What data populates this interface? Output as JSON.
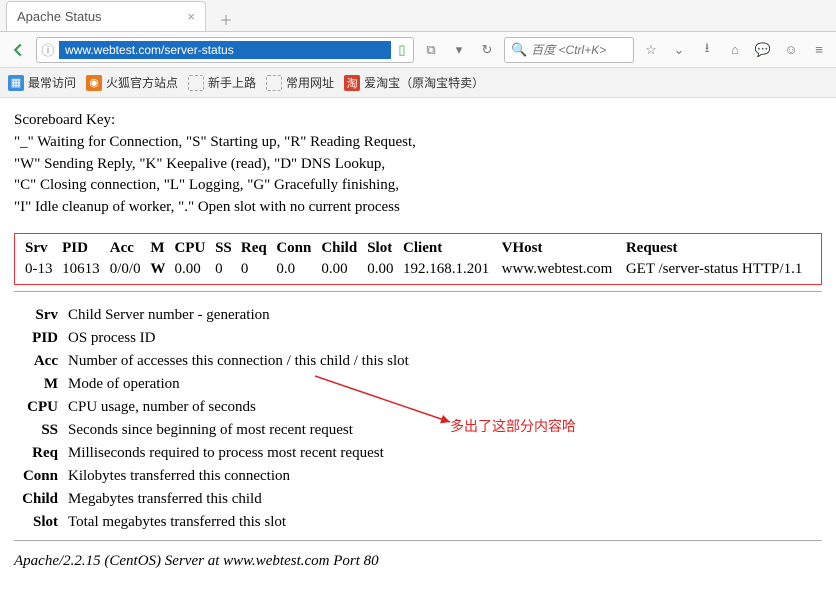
{
  "browser": {
    "tab_title": "Apache Status",
    "url": "www.webtest.com/server-status",
    "search_placeholder": "百度 <Ctrl+K>",
    "bookmarks": [
      {
        "label": "最常访问"
      },
      {
        "label": "火狐官方站点"
      },
      {
        "label": "新手上路"
      },
      {
        "label": "常用网址"
      },
      {
        "label": "爱淘宝（原淘宝特卖）"
      }
    ]
  },
  "scoreboard": {
    "title": "Scoreboard Key:",
    "lines": [
      "\"_\" Waiting for Connection, \"S\" Starting up, \"R\" Reading Request,",
      "\"W\" Sending Reply, \"K\" Keepalive (read), \"D\" DNS Lookup,",
      "\"C\" Closing connection, \"L\" Logging, \"G\" Gracefully finishing,",
      "\"I\" Idle cleanup of worker, \".\" Open slot with no current process"
    ]
  },
  "table": {
    "headers": [
      "Srv",
      "PID",
      "Acc",
      "M",
      "CPU",
      "SS",
      "Req",
      "Conn",
      "Child",
      "Slot",
      "Client",
      "VHost",
      "Request"
    ],
    "row": {
      "Srv": "0-13",
      "PID": "10613",
      "Acc": "0/0/0",
      "M": "W",
      "CPU": "0.00",
      "SS": "0",
      "Req": "0",
      "Conn": "0.0",
      "Child": "0.00",
      "Slot": "0.00",
      "Client": "192.168.1.201",
      "VHost": "www.webtest.com",
      "Request": "GET /server-status HTTP/1.1"
    }
  },
  "defs": [
    {
      "k": "Srv",
      "v": "Child Server number - generation"
    },
    {
      "k": "PID",
      "v": "OS process ID"
    },
    {
      "k": "Acc",
      "v": "Number of accesses this connection / this child / this slot"
    },
    {
      "k": "M",
      "v": "Mode of operation"
    },
    {
      "k": "CPU",
      "v": "CPU usage, number of seconds"
    },
    {
      "k": "SS",
      "v": "Seconds since beginning of most recent request"
    },
    {
      "k": "Req",
      "v": "Milliseconds required to process most recent request"
    },
    {
      "k": "Conn",
      "v": "Kilobytes transferred this connection"
    },
    {
      "k": "Child",
      "v": "Megabytes transferred this child"
    },
    {
      "k": "Slot",
      "v": "Total megabytes transferred this slot"
    }
  ],
  "footer": "Apache/2.2.15 (CentOS) Server at www.webtest.com Port 80",
  "annotation": "多出了这部分内容哈"
}
